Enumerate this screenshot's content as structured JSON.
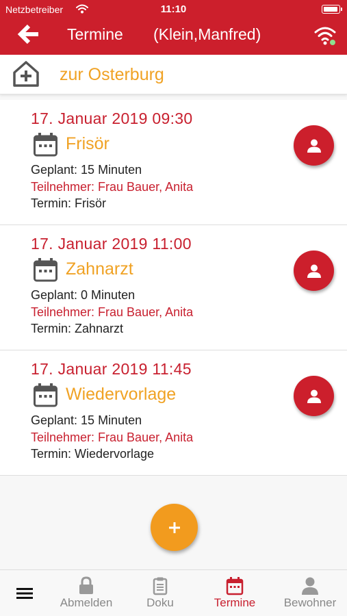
{
  "status_bar": {
    "carrier": "Netzbetreiber",
    "time": "11:10"
  },
  "nav": {
    "title": "Termine",
    "subtitle": "(Klein,Manfred)"
  },
  "location": {
    "name": "zur Osterburg"
  },
  "appointments": [
    {
      "date": "17. Januar 2019  09:30",
      "title": "Frisör",
      "planned": "Geplant: 15 Minuten",
      "participant": "Teilnehmer: Frau Bauer, Anita",
      "termin": "Termin: Frisör"
    },
    {
      "date": "17. Januar 2019  11:00",
      "title": "Zahnarzt",
      "planned": "Geplant: 0 Minuten",
      "participant": "Teilnehmer: Frau Bauer, Anita",
      "termin": "Termin: Zahnarzt"
    },
    {
      "date": "17. Januar 2019  11:45",
      "title": "Wiedervorlage",
      "planned": "Geplant: 15 Minuten",
      "participant": "Teilnehmer: Frau Bauer, Anita",
      "termin": "Termin: Wiedervorlage"
    }
  ],
  "tabs": [
    {
      "label": "Abmelden",
      "icon": "lock-icon"
    },
    {
      "label": "Doku",
      "icon": "clipboard-icon"
    },
    {
      "label": "Termine",
      "icon": "calendar-icon",
      "active": true
    },
    {
      "label": "Bewohner",
      "icon": "person-icon"
    }
  ],
  "colors": {
    "brand_red": "#cc1f2c",
    "accent_orange": "#f0a224",
    "fab_orange": "#f29b1e",
    "online_green": "#8fe08f"
  }
}
